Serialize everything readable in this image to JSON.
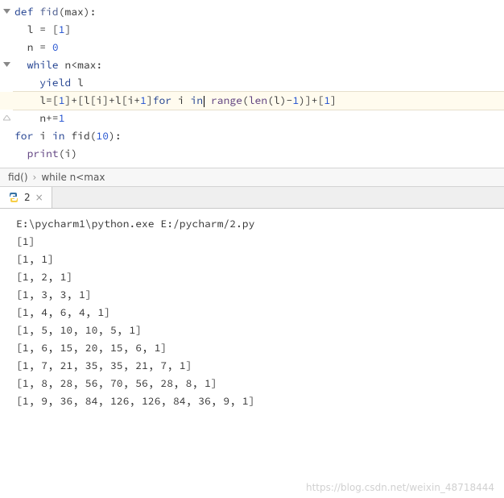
{
  "code": {
    "l1": {
      "def": "def ",
      "fn": "fid",
      "rest": "(max):"
    },
    "l2": "l = [",
    "l2b": "1",
    "l2c": "]",
    "l3a": "n = ",
    "l3b": "0",
    "l4a": "while ",
    "l4b": "n<max:",
    "l5a": "yield ",
    "l5b": "l",
    "l6a": "l=[",
    "l6b": "1",
    "l6c": "]+[l[i]+l[i+",
    "l6d": "1",
    "l6e": "]",
    "l6f": "for ",
    "l6g": "i ",
    "l6h": "in",
    "l6i": " range",
    "l6j": "(",
    "l6k": "len",
    "l6l": "(l)-",
    "l6m": "1",
    "l6n": ")]+[",
    "l6o": "1",
    "l6p": "]",
    "l7a": "n+=",
    "l7b": "1",
    "l8a": "for ",
    "l8b": "i ",
    "l8c": "in ",
    "l8d": "fid(",
    "l8e": "10",
    "l8f": "):",
    "l9a": "print",
    "l9b": "(i)"
  },
  "indent": {
    "d0": "",
    "d1": "  ",
    "d2": "    "
  },
  "breadcrumb": {
    "seg1": "fid()",
    "sep": "›",
    "seg2": "while n<max"
  },
  "tab": {
    "label": "2",
    "close": "×"
  },
  "console": {
    "cmd": "E:\\pycharm1\\python.exe E:/pycharm/2.py",
    "out": [
      "[1]",
      "[1, 1]",
      "[1, 2, 1]",
      "[1, 3, 3, 1]",
      "[1, 4, 6, 4, 1]",
      "[1, 5, 10, 10, 5, 1]",
      "[1, 6, 15, 20, 15, 6, 1]",
      "[1, 7, 21, 35, 35, 21, 7, 1]",
      "[1, 8, 28, 56, 70, 56, 28, 8, 1]",
      "[1, 9, 36, 84, 126, 126, 84, 36, 9, 1]"
    ]
  },
  "watermark": "https://blog.csdn.net/weixin_48718444"
}
